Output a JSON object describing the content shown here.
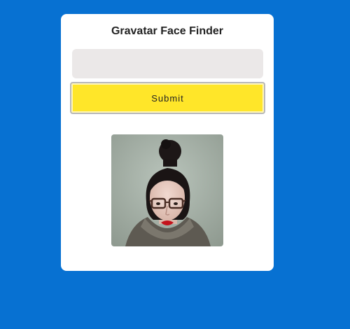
{
  "app": {
    "title": "Gravatar Face Finder"
  },
  "form": {
    "email_value": "",
    "email_placeholder": "",
    "submit_label": "Submit"
  },
  "avatar": {
    "alt": "Gravatar avatar"
  },
  "colors": {
    "background": "#0771d2",
    "card": "#ffffff",
    "input": "#ebe8e8",
    "button": "#ffe629"
  }
}
